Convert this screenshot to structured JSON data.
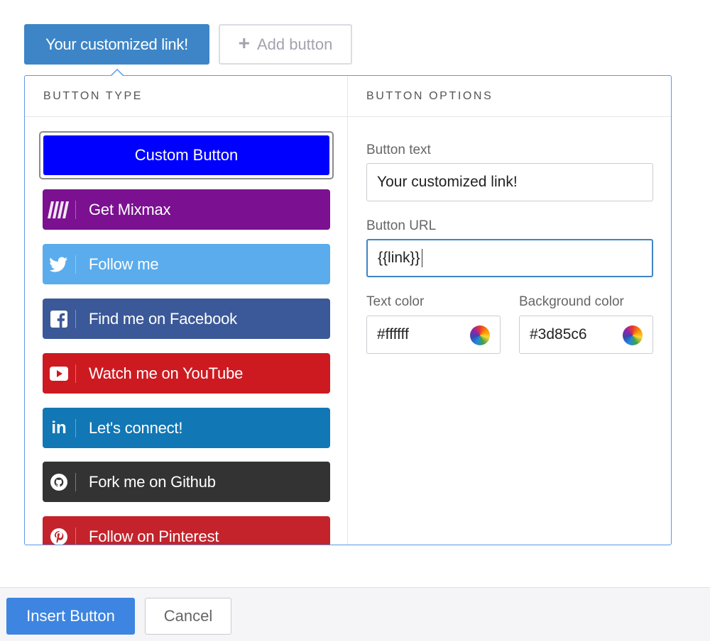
{
  "top_bar": {
    "active_tab_label": "Your customized link!",
    "add_button_label": "Add button"
  },
  "button_type": {
    "header": "BUTTON TYPE",
    "selected_label": "Custom Button",
    "selected_bg": "#0000ff",
    "items": [
      {
        "label": "Get Mixmax",
        "icon": "mixmax-logo-icon",
        "bg": "#7b1190"
      },
      {
        "label": "Follow me",
        "icon": "twitter-icon",
        "bg": "#5aacec"
      },
      {
        "label": "Find me on Facebook",
        "icon": "facebook-icon",
        "bg": "#3b5998"
      },
      {
        "label": "Watch me on YouTube",
        "icon": "youtube-icon",
        "bg": "#cd1a21"
      },
      {
        "label": "Let's connect!",
        "icon": "linkedin-icon",
        "bg": "#1277b5"
      },
      {
        "label": "Fork me on Github",
        "icon": "github-icon",
        "bg": "#333333"
      },
      {
        "label": "Follow on Pinterest",
        "icon": "pinterest-icon",
        "bg": "#c4232b"
      }
    ]
  },
  "button_options": {
    "header": "BUTTON OPTIONS",
    "text_label": "Button text",
    "text_value": "Your customized link!",
    "url_label": "Button URL",
    "url_value": "{{link}}",
    "text_color_label": "Text color",
    "text_color_value": "#ffffff",
    "bg_color_label": "Background color",
    "bg_color_value": "#3d85c6"
  },
  "footer": {
    "insert_label": "Insert Button",
    "cancel_label": "Cancel"
  }
}
